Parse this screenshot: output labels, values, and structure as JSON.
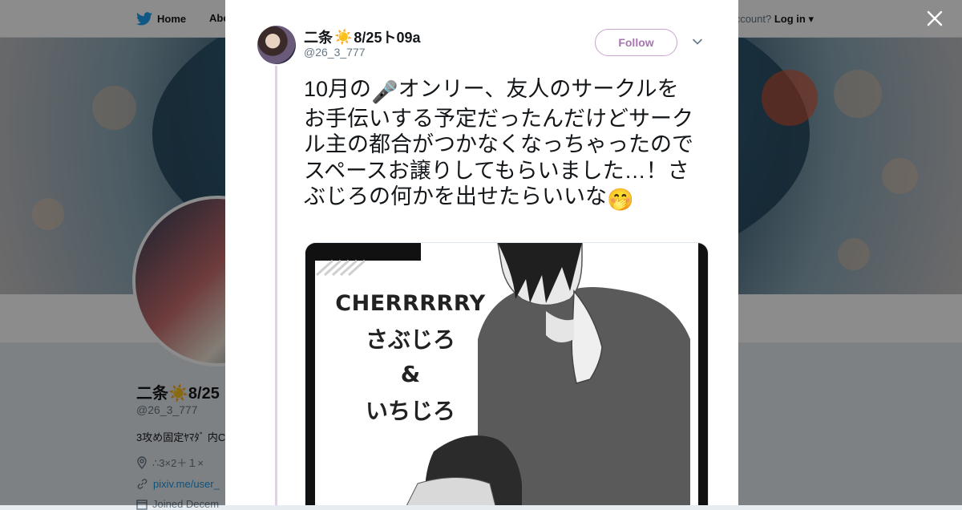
{
  "background_page": {
    "nav": {
      "home_label": "Home",
      "about_label": "Abo",
      "account_text": "ccount?",
      "login_label": "Log in"
    },
    "profile": {
      "name": "二条☀️8/25",
      "handle": "@26_3_777",
      "bio": "3攻め固定ﾔﾏﾀﾞ 内С",
      "location": "∴3×2＋１×",
      "link": "pixiv.me/user_",
      "joined": "Joined Decem"
    }
  },
  "modal": {
    "user": {
      "display_name": "二条",
      "sun_emoji": "☀️",
      "name_suffix": "8/25ト09a",
      "handle": "@26_3_777"
    },
    "follow_label": "Follow",
    "tweet": {
      "text_before_emoji": "10月の",
      "mic_emoji": "🎤",
      "text_after_emoji": "オンリー、友人のサークルをお手伝いする予定だったんだけどサークル主の都合がつかなくなっちゃったのでスペースお譲りしてもらいました…！さぶじろの何かを出せたらいいな",
      "end_emoji": "🤭"
    },
    "image": {
      "title": "CHERRRRRY",
      "line1": "さぶじろ",
      "line2": "&",
      "line3": "いちじろ"
    }
  },
  "colors": {
    "follow_accent": "#a776b1",
    "thread_line": "#e6cde9",
    "link_blue": "#1b95e0",
    "twitter_blue": "#1da1f2"
  }
}
